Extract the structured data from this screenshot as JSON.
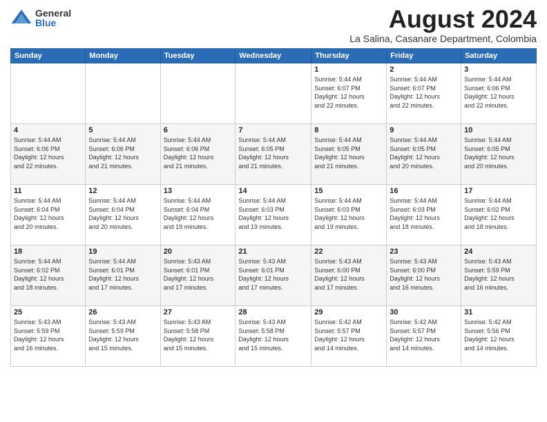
{
  "header": {
    "logo_general": "General",
    "logo_blue": "Blue",
    "month_year": "August 2024",
    "location": "La Salina, Casanare Department, Colombia"
  },
  "days_of_week": [
    "Sunday",
    "Monday",
    "Tuesday",
    "Wednesday",
    "Thursday",
    "Friday",
    "Saturday"
  ],
  "weeks": [
    [
      {
        "day": "",
        "info": ""
      },
      {
        "day": "",
        "info": ""
      },
      {
        "day": "",
        "info": ""
      },
      {
        "day": "",
        "info": ""
      },
      {
        "day": "1",
        "info": "Sunrise: 5:44 AM\nSunset: 6:07 PM\nDaylight: 12 hours\nand 22 minutes."
      },
      {
        "day": "2",
        "info": "Sunrise: 5:44 AM\nSunset: 6:07 PM\nDaylight: 12 hours\nand 22 minutes."
      },
      {
        "day": "3",
        "info": "Sunrise: 5:44 AM\nSunset: 6:06 PM\nDaylight: 12 hours\nand 22 minutes."
      }
    ],
    [
      {
        "day": "4",
        "info": "Sunrise: 5:44 AM\nSunset: 6:06 PM\nDaylight: 12 hours\nand 22 minutes."
      },
      {
        "day": "5",
        "info": "Sunrise: 5:44 AM\nSunset: 6:06 PM\nDaylight: 12 hours\nand 21 minutes."
      },
      {
        "day": "6",
        "info": "Sunrise: 5:44 AM\nSunset: 6:06 PM\nDaylight: 12 hours\nand 21 minutes."
      },
      {
        "day": "7",
        "info": "Sunrise: 5:44 AM\nSunset: 6:05 PM\nDaylight: 12 hours\nand 21 minutes."
      },
      {
        "day": "8",
        "info": "Sunrise: 5:44 AM\nSunset: 6:05 PM\nDaylight: 12 hours\nand 21 minutes."
      },
      {
        "day": "9",
        "info": "Sunrise: 5:44 AM\nSunset: 6:05 PM\nDaylight: 12 hours\nand 20 minutes."
      },
      {
        "day": "10",
        "info": "Sunrise: 5:44 AM\nSunset: 6:05 PM\nDaylight: 12 hours\nand 20 minutes."
      }
    ],
    [
      {
        "day": "11",
        "info": "Sunrise: 5:44 AM\nSunset: 6:04 PM\nDaylight: 12 hours\nand 20 minutes."
      },
      {
        "day": "12",
        "info": "Sunrise: 5:44 AM\nSunset: 6:04 PM\nDaylight: 12 hours\nand 20 minutes."
      },
      {
        "day": "13",
        "info": "Sunrise: 5:44 AM\nSunset: 6:04 PM\nDaylight: 12 hours\nand 19 minutes."
      },
      {
        "day": "14",
        "info": "Sunrise: 5:44 AM\nSunset: 6:03 PM\nDaylight: 12 hours\nand 19 minutes."
      },
      {
        "day": "15",
        "info": "Sunrise: 5:44 AM\nSunset: 6:03 PM\nDaylight: 12 hours\nand 19 minutes."
      },
      {
        "day": "16",
        "info": "Sunrise: 5:44 AM\nSunset: 6:03 PM\nDaylight: 12 hours\nand 18 minutes."
      },
      {
        "day": "17",
        "info": "Sunrise: 5:44 AM\nSunset: 6:02 PM\nDaylight: 12 hours\nand 18 minutes."
      }
    ],
    [
      {
        "day": "18",
        "info": "Sunrise: 5:44 AM\nSunset: 6:02 PM\nDaylight: 12 hours\nand 18 minutes."
      },
      {
        "day": "19",
        "info": "Sunrise: 5:44 AM\nSunset: 6:01 PM\nDaylight: 12 hours\nand 17 minutes."
      },
      {
        "day": "20",
        "info": "Sunrise: 5:43 AM\nSunset: 6:01 PM\nDaylight: 12 hours\nand 17 minutes."
      },
      {
        "day": "21",
        "info": "Sunrise: 5:43 AM\nSunset: 6:01 PM\nDaylight: 12 hours\nand 17 minutes."
      },
      {
        "day": "22",
        "info": "Sunrise: 5:43 AM\nSunset: 6:00 PM\nDaylight: 12 hours\nand 17 minutes."
      },
      {
        "day": "23",
        "info": "Sunrise: 5:43 AM\nSunset: 6:00 PM\nDaylight: 12 hours\nand 16 minutes."
      },
      {
        "day": "24",
        "info": "Sunrise: 5:43 AM\nSunset: 5:59 PM\nDaylight: 12 hours\nand 16 minutes."
      }
    ],
    [
      {
        "day": "25",
        "info": "Sunrise: 5:43 AM\nSunset: 5:59 PM\nDaylight: 12 hours\nand 16 minutes."
      },
      {
        "day": "26",
        "info": "Sunrise: 5:43 AM\nSunset: 5:59 PM\nDaylight: 12 hours\nand 15 minutes."
      },
      {
        "day": "27",
        "info": "Sunrise: 5:43 AM\nSunset: 5:58 PM\nDaylight: 12 hours\nand 15 minutes."
      },
      {
        "day": "28",
        "info": "Sunrise: 5:43 AM\nSunset: 5:58 PM\nDaylight: 12 hours\nand 15 minutes."
      },
      {
        "day": "29",
        "info": "Sunrise: 5:42 AM\nSunset: 5:57 PM\nDaylight: 12 hours\nand 14 minutes."
      },
      {
        "day": "30",
        "info": "Sunrise: 5:42 AM\nSunset: 5:57 PM\nDaylight: 12 hours\nand 14 minutes."
      },
      {
        "day": "31",
        "info": "Sunrise: 5:42 AM\nSunset: 5:56 PM\nDaylight: 12 hours\nand 14 minutes."
      }
    ]
  ]
}
